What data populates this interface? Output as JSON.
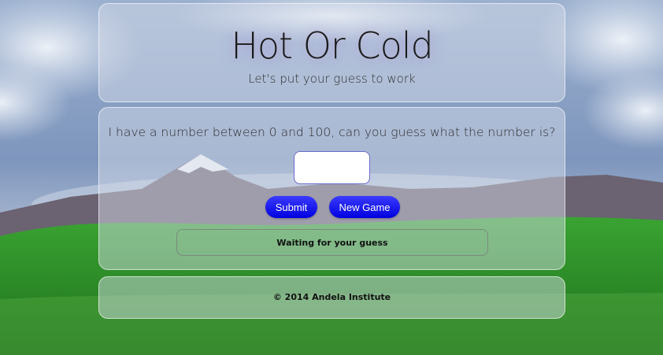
{
  "header": {
    "title": "Hot Or Cold",
    "subtitle": "Let's put your guess to work"
  },
  "game": {
    "prompt": "I have a number between 0 and 100, can you guess what the number is?",
    "guess_value": "",
    "submit_label": "Submit",
    "new_game_label": "New Game",
    "feedback": "Waiting for your guess"
  },
  "footer": {
    "copyright": "© 2014 Andela Institute"
  },
  "colors": {
    "button": "#1a1aff",
    "sky": "#8fa6c8",
    "grass": "#2f8f2a"
  }
}
